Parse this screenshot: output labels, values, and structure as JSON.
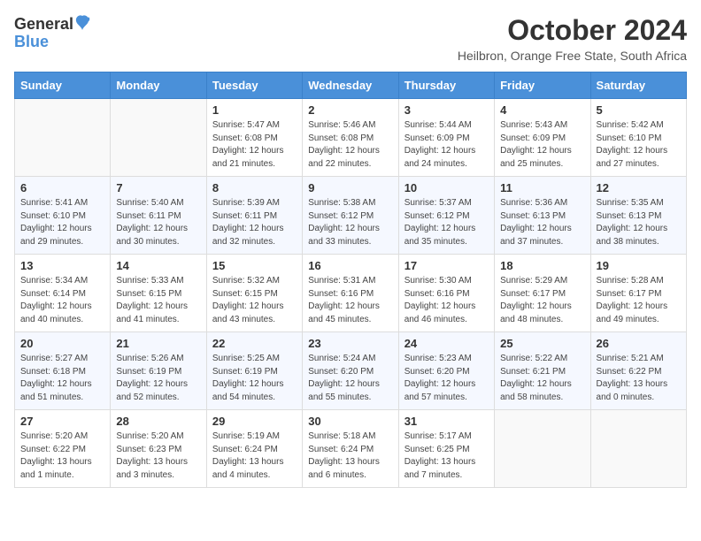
{
  "header": {
    "logo_general": "General",
    "logo_blue": "Blue",
    "month_title": "October 2024",
    "location": "Heilbron, Orange Free State, South Africa"
  },
  "days_of_week": [
    "Sunday",
    "Monday",
    "Tuesday",
    "Wednesday",
    "Thursday",
    "Friday",
    "Saturday"
  ],
  "weeks": [
    [
      {
        "day": "",
        "sunrise": "",
        "sunset": "",
        "daylight": ""
      },
      {
        "day": "",
        "sunrise": "",
        "sunset": "",
        "daylight": ""
      },
      {
        "day": "1",
        "sunrise": "Sunrise: 5:47 AM",
        "sunset": "Sunset: 6:08 PM",
        "daylight": "Daylight: 12 hours and 21 minutes."
      },
      {
        "day": "2",
        "sunrise": "Sunrise: 5:46 AM",
        "sunset": "Sunset: 6:08 PM",
        "daylight": "Daylight: 12 hours and 22 minutes."
      },
      {
        "day": "3",
        "sunrise": "Sunrise: 5:44 AM",
        "sunset": "Sunset: 6:09 PM",
        "daylight": "Daylight: 12 hours and 24 minutes."
      },
      {
        "day": "4",
        "sunrise": "Sunrise: 5:43 AM",
        "sunset": "Sunset: 6:09 PM",
        "daylight": "Daylight: 12 hours and 25 minutes."
      },
      {
        "day": "5",
        "sunrise": "Sunrise: 5:42 AM",
        "sunset": "Sunset: 6:10 PM",
        "daylight": "Daylight: 12 hours and 27 minutes."
      }
    ],
    [
      {
        "day": "6",
        "sunrise": "Sunrise: 5:41 AM",
        "sunset": "Sunset: 6:10 PM",
        "daylight": "Daylight: 12 hours and 29 minutes."
      },
      {
        "day": "7",
        "sunrise": "Sunrise: 5:40 AM",
        "sunset": "Sunset: 6:11 PM",
        "daylight": "Daylight: 12 hours and 30 minutes."
      },
      {
        "day": "8",
        "sunrise": "Sunrise: 5:39 AM",
        "sunset": "Sunset: 6:11 PM",
        "daylight": "Daylight: 12 hours and 32 minutes."
      },
      {
        "day": "9",
        "sunrise": "Sunrise: 5:38 AM",
        "sunset": "Sunset: 6:12 PM",
        "daylight": "Daylight: 12 hours and 33 minutes."
      },
      {
        "day": "10",
        "sunrise": "Sunrise: 5:37 AM",
        "sunset": "Sunset: 6:12 PM",
        "daylight": "Daylight: 12 hours and 35 minutes."
      },
      {
        "day": "11",
        "sunrise": "Sunrise: 5:36 AM",
        "sunset": "Sunset: 6:13 PM",
        "daylight": "Daylight: 12 hours and 37 minutes."
      },
      {
        "day": "12",
        "sunrise": "Sunrise: 5:35 AM",
        "sunset": "Sunset: 6:13 PM",
        "daylight": "Daylight: 12 hours and 38 minutes."
      }
    ],
    [
      {
        "day": "13",
        "sunrise": "Sunrise: 5:34 AM",
        "sunset": "Sunset: 6:14 PM",
        "daylight": "Daylight: 12 hours and 40 minutes."
      },
      {
        "day": "14",
        "sunrise": "Sunrise: 5:33 AM",
        "sunset": "Sunset: 6:15 PM",
        "daylight": "Daylight: 12 hours and 41 minutes."
      },
      {
        "day": "15",
        "sunrise": "Sunrise: 5:32 AM",
        "sunset": "Sunset: 6:15 PM",
        "daylight": "Daylight: 12 hours and 43 minutes."
      },
      {
        "day": "16",
        "sunrise": "Sunrise: 5:31 AM",
        "sunset": "Sunset: 6:16 PM",
        "daylight": "Daylight: 12 hours and 45 minutes."
      },
      {
        "day": "17",
        "sunrise": "Sunrise: 5:30 AM",
        "sunset": "Sunset: 6:16 PM",
        "daylight": "Daylight: 12 hours and 46 minutes."
      },
      {
        "day": "18",
        "sunrise": "Sunrise: 5:29 AM",
        "sunset": "Sunset: 6:17 PM",
        "daylight": "Daylight: 12 hours and 48 minutes."
      },
      {
        "day": "19",
        "sunrise": "Sunrise: 5:28 AM",
        "sunset": "Sunset: 6:17 PM",
        "daylight": "Daylight: 12 hours and 49 minutes."
      }
    ],
    [
      {
        "day": "20",
        "sunrise": "Sunrise: 5:27 AM",
        "sunset": "Sunset: 6:18 PM",
        "daylight": "Daylight: 12 hours and 51 minutes."
      },
      {
        "day": "21",
        "sunrise": "Sunrise: 5:26 AM",
        "sunset": "Sunset: 6:19 PM",
        "daylight": "Daylight: 12 hours and 52 minutes."
      },
      {
        "day": "22",
        "sunrise": "Sunrise: 5:25 AM",
        "sunset": "Sunset: 6:19 PM",
        "daylight": "Daylight: 12 hours and 54 minutes."
      },
      {
        "day": "23",
        "sunrise": "Sunrise: 5:24 AM",
        "sunset": "Sunset: 6:20 PM",
        "daylight": "Daylight: 12 hours and 55 minutes."
      },
      {
        "day": "24",
        "sunrise": "Sunrise: 5:23 AM",
        "sunset": "Sunset: 6:20 PM",
        "daylight": "Daylight: 12 hours and 57 minutes."
      },
      {
        "day": "25",
        "sunrise": "Sunrise: 5:22 AM",
        "sunset": "Sunset: 6:21 PM",
        "daylight": "Daylight: 12 hours and 58 minutes."
      },
      {
        "day": "26",
        "sunrise": "Sunrise: 5:21 AM",
        "sunset": "Sunset: 6:22 PM",
        "daylight": "Daylight: 13 hours and 0 minutes."
      }
    ],
    [
      {
        "day": "27",
        "sunrise": "Sunrise: 5:20 AM",
        "sunset": "Sunset: 6:22 PM",
        "daylight": "Daylight: 13 hours and 1 minute."
      },
      {
        "day": "28",
        "sunrise": "Sunrise: 5:20 AM",
        "sunset": "Sunset: 6:23 PM",
        "daylight": "Daylight: 13 hours and 3 minutes."
      },
      {
        "day": "29",
        "sunrise": "Sunrise: 5:19 AM",
        "sunset": "Sunset: 6:24 PM",
        "daylight": "Daylight: 13 hours and 4 minutes."
      },
      {
        "day": "30",
        "sunrise": "Sunrise: 5:18 AM",
        "sunset": "Sunset: 6:24 PM",
        "daylight": "Daylight: 13 hours and 6 minutes."
      },
      {
        "day": "31",
        "sunrise": "Sunrise: 5:17 AM",
        "sunset": "Sunset: 6:25 PM",
        "daylight": "Daylight: 13 hours and 7 minutes."
      },
      {
        "day": "",
        "sunrise": "",
        "sunset": "",
        "daylight": ""
      },
      {
        "day": "",
        "sunrise": "",
        "sunset": "",
        "daylight": ""
      }
    ]
  ]
}
